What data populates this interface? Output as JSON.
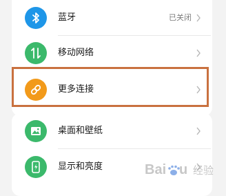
{
  "settings": {
    "items": [
      {
        "label": "蓝牙",
        "value": "已关闭",
        "icon": "bluetooth-icon",
        "color": "#1e96e8"
      },
      {
        "label": "移动网络",
        "icon": "mobile-network-icon",
        "color": "#3bb96b"
      },
      {
        "label": "更多连接",
        "icon": "link-icon",
        "color": "#f29a1a"
      },
      {
        "label": "桌面和壁纸",
        "icon": "wallpaper-icon",
        "color": "#3bb96b"
      },
      {
        "label": "显示和亮度",
        "icon": "display-brightness-icon",
        "color": "#3bb96b"
      }
    ]
  },
  "highlight_color": "#c9713f",
  "watermark": {
    "text": "Baidu 经验"
  }
}
